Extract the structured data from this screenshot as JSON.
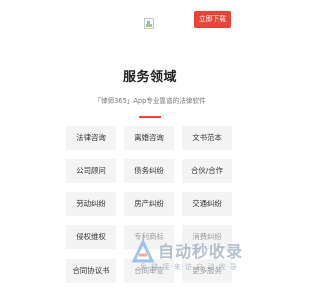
{
  "header": {
    "logo_icon": "broken-image-icon",
    "download_label": "立即下载"
  },
  "section": {
    "title": "服务领域",
    "subtitle": "「律师365」App专业靠谱的法律软件",
    "accent_color": "#e8443a"
  },
  "services": [
    {
      "label": "法律咨询"
    },
    {
      "label": "离婚咨询"
    },
    {
      "label": "文书范本"
    },
    {
      "label": "公司顾问"
    },
    {
      "label": "债务纠纷"
    },
    {
      "label": "合伙/合作"
    },
    {
      "label": "劳动纠纷"
    },
    {
      "label": "房产纠纷"
    },
    {
      "label": "交通纠纷"
    },
    {
      "label": "侵权维权"
    },
    {
      "label": "专利商标"
    },
    {
      "label": "消费纠纷"
    },
    {
      "label": "合同协议书"
    },
    {
      "label": "合同审查"
    },
    {
      "label": "更多服务"
    }
  ],
  "watermark": {
    "main_text": "自动秒收录",
    "sub_text": "免·链·接·来·访·自·动·收·录"
  }
}
